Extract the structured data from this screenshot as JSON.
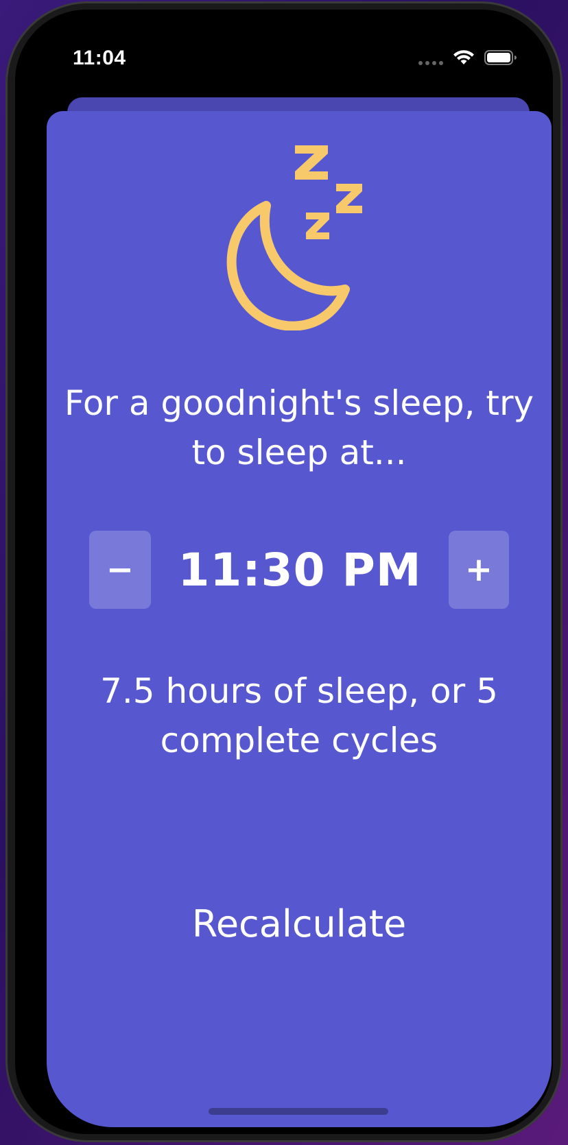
{
  "status_bar": {
    "time": "11:04"
  },
  "icons": {
    "moon": "moon-with-zzz-icon",
    "wifi": "wifi-icon",
    "battery": "battery-icon"
  },
  "colors": {
    "sheet_background": "#5758d0",
    "accent_yellow": "#f7c96b",
    "text": "#ffffff"
  },
  "main": {
    "headline": "For a goodnight's sleep, try to sleep at...",
    "stepper": {
      "minus_label": "−",
      "time": "11:30 PM",
      "plus_label": "+"
    },
    "summary": "7.5 hours of sleep, or 5 complete cycles",
    "recalculate_label": "Recalculate"
  }
}
